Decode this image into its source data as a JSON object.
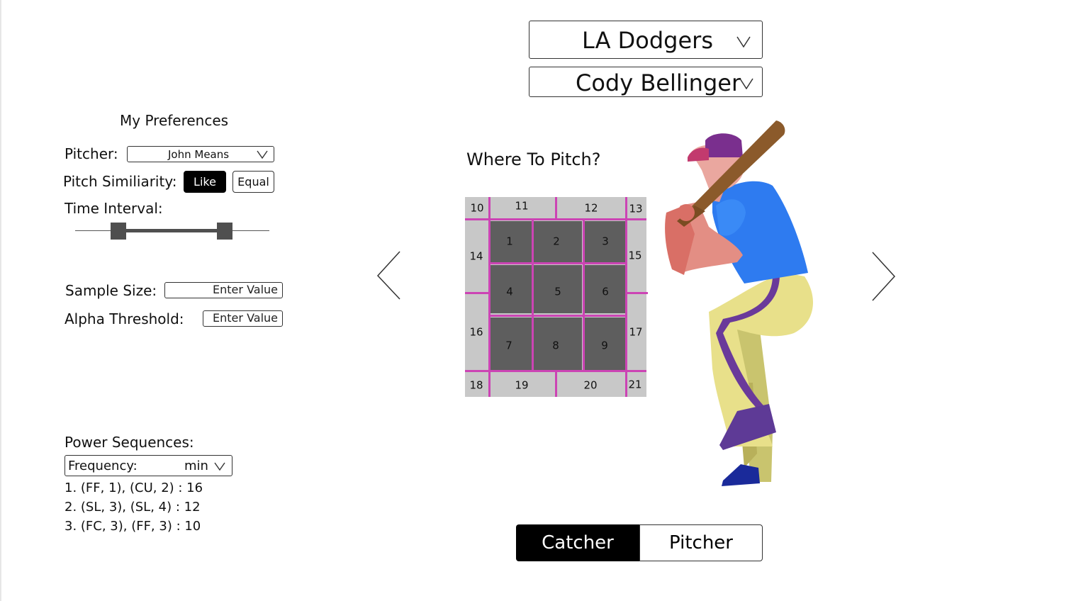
{
  "team_select": {
    "value": "LA Dodgers"
  },
  "player_select": {
    "value": "Cody Bellinger"
  },
  "preferences": {
    "title": "My Preferences",
    "pitcher_label": "Pitcher:",
    "pitcher_value": "John Means",
    "similarity_label": "Pitch Similiarity:",
    "similarity_options": [
      "Like",
      "Equal"
    ],
    "similarity_selected": "Like",
    "time_interval_label": "Time Interval:",
    "sample_size_label": "Sample Size:",
    "sample_size_placeholder": "Enter Value",
    "alpha_label": "Alpha Threshold:",
    "alpha_placeholder": "Enter Value"
  },
  "power_sequences": {
    "title": "Power Sequences:",
    "frequency_label": "Frequency:",
    "frequency_value": "min",
    "items": [
      "1. (FF, 1), (CU, 2) : 16",
      "2. (SL, 3), (SL, 4) : 12",
      "3. (FC, 3), (FF, 3) : 10"
    ]
  },
  "zone": {
    "title": "Where To Pitch?",
    "inner": [
      "1",
      "2",
      "3",
      "4",
      "5",
      "6",
      "7",
      "8",
      "9"
    ],
    "outer": [
      "10",
      "11",
      "12",
      "13",
      "14",
      "15",
      "16",
      "17",
      "18",
      "19",
      "20",
      "21"
    ]
  },
  "view_toggle": {
    "options": [
      "Catcher",
      "Pitcher"
    ],
    "selected": "Catcher"
  },
  "icons": {
    "chevron": "chevron-down-icon",
    "prev": "arrow-left-icon",
    "next": "arrow-right-icon",
    "figure": "baseball-batter-illustration"
  },
  "colors": {
    "zone_line": "#cc44b4",
    "zone_inner": "#5e5e5e",
    "zone_outer": "#c8c8c8",
    "active": "#000000"
  }
}
